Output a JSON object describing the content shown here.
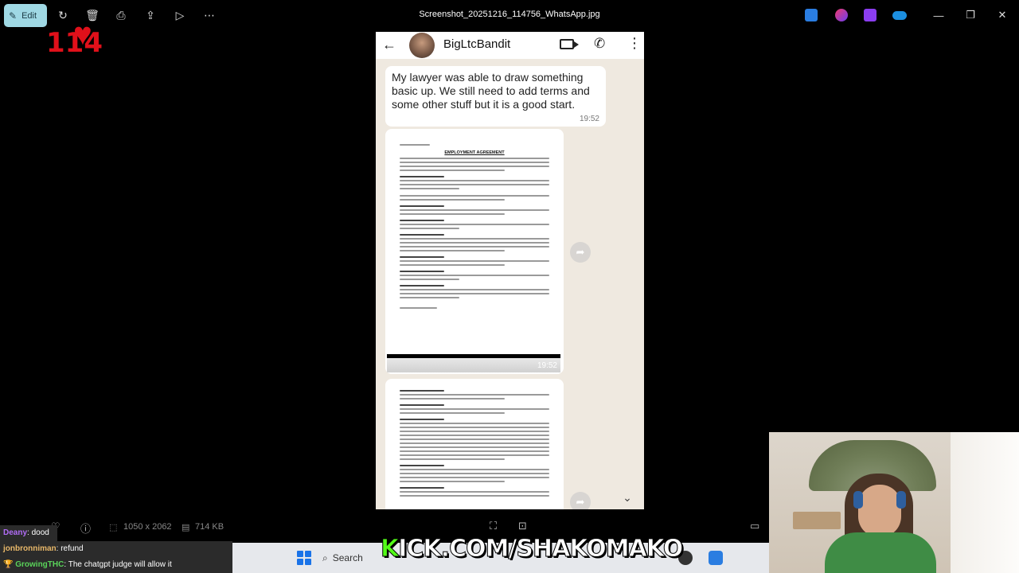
{
  "titlebar": {
    "edit_label": "Edit",
    "title": "Screenshot_20251216_114756_WhatsApp.jpg",
    "tools": [
      "rotate-icon",
      "delete-icon",
      "print-icon",
      "share-icon",
      "slideshow-icon",
      "more-icon"
    ],
    "window_controls": [
      "minimize-icon",
      "restore-icon",
      "close-icon"
    ]
  },
  "overlay": {
    "counter": "114"
  },
  "whatsapp": {
    "contact": "BigLtcBandit",
    "message": "My lawyer was able to draw something basic up. We still need to add terms and some other stuff but it is a good start.",
    "message_time": "19:52",
    "doc_time": "19:52",
    "doc_title": "EMPLOYMENT AGREEMENT"
  },
  "infobar": {
    "dimensions": "1050 x 2062",
    "size": "714 KB"
  },
  "chat": [
    {
      "user": "Deany",
      "text": ": dood",
      "color": "#b26df7"
    },
    {
      "user": "jonbronniman",
      "text": ": refund",
      "color": "#e8b86a"
    },
    {
      "user": "GrowingTHC",
      "text": ": The chatgpt judge will allow it",
      "color": "#5ad35a"
    }
  ],
  "taskbar": {
    "search_label": "Search"
  },
  "stream_overlay": {
    "kick_prefix": "K",
    "kick_rest": "ICK.COM/SHAKOMAKO"
  }
}
